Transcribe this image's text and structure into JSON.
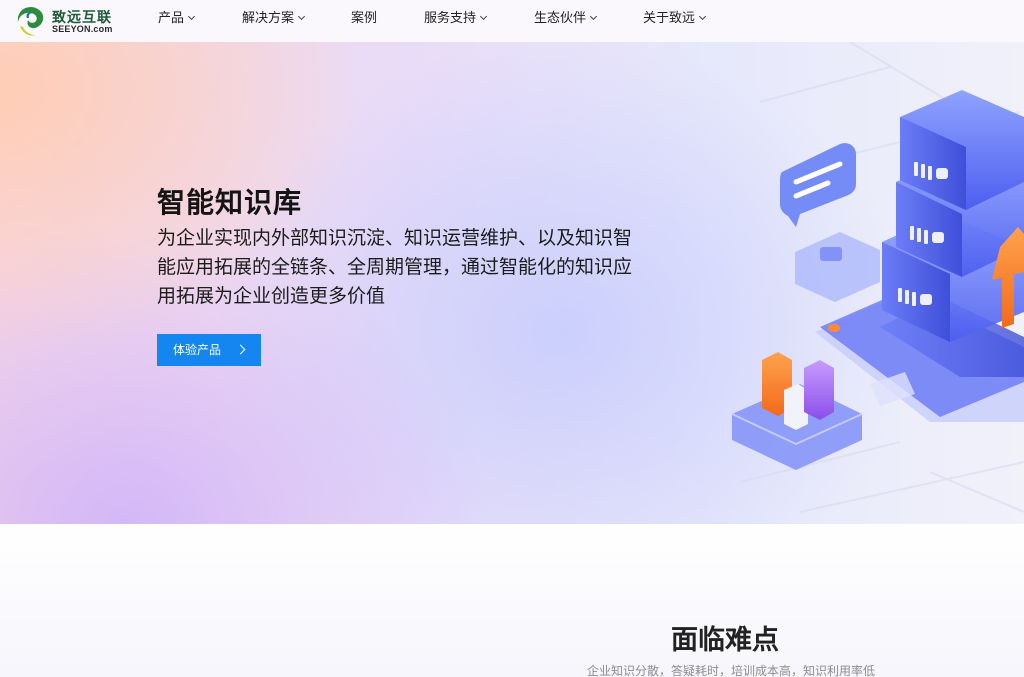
{
  "brand": {
    "name_cn": "致远互联",
    "name_en": "SEEYON.com",
    "logo_icon": "seeyon-swirl-logo",
    "colors": {
      "green": "#2e8b3e",
      "yellow": "#c8d22a",
      "blue": "#1b6fb3"
    }
  },
  "nav": {
    "items": [
      {
        "label": "产品",
        "has_dropdown": true
      },
      {
        "label": "解决方案",
        "has_dropdown": true
      },
      {
        "label": "案例",
        "has_dropdown": false
      },
      {
        "label": "服务支持",
        "has_dropdown": true
      },
      {
        "label": "生态伙伴",
        "has_dropdown": true
      },
      {
        "label": "关于致远",
        "has_dropdown": true
      }
    ],
    "dropdown_icon": "chevron-down-icon"
  },
  "hero": {
    "title": "智能知识库",
    "description": "为企业实现内外部知识沉淀、知识运营维护、以及知识智能应用拓展的全链条、全周期管理，通过智能化的知识应用拓展为企业创造更多价值",
    "cta_label": "体验产品",
    "cta_icon": "chevron-right-icon",
    "accent_color": "#1586f0",
    "illustration": "isometric-server-stack-with-chat-bubble-bar-chart-and-up-arrow"
  },
  "section": {
    "title": "面临难点",
    "subtitle": "企业知识分散，答疑耗时，培训成本高，知识利用率低"
  }
}
